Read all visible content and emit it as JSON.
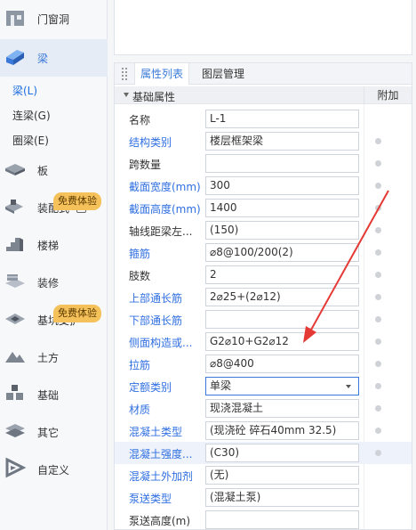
{
  "sidebar": {
    "items": [
      {
        "label": "门窗洞",
        "icon": "door-window-icon"
      },
      {
        "label": "梁",
        "icon": "beam-icon"
      },
      {
        "label": "板",
        "icon": "slab-icon"
      },
      {
        "label": "装配式",
        "icon": "prefab-icon"
      },
      {
        "label": "楼梯",
        "icon": "stairs-icon"
      },
      {
        "label": "装修",
        "icon": "decoration-icon"
      },
      {
        "label": "基坑支护",
        "icon": "foundation-pit-icon"
      },
      {
        "label": "土方",
        "icon": "earthwork-icon"
      },
      {
        "label": "基础",
        "icon": "foundation-icon"
      },
      {
        "label": "其它",
        "icon": "other-icon"
      },
      {
        "label": "自定义",
        "icon": "custom-icon"
      }
    ],
    "sub_items": [
      "梁(L)",
      "连梁(G)",
      "圈梁(E)"
    ],
    "badges": [
      "免费体验",
      "免费体验"
    ]
  },
  "panel": {
    "tabs": [
      "属性列表",
      "图层管理"
    ],
    "section_title": "基础属性",
    "extra_header": "附加",
    "rows": [
      {
        "name": "名称",
        "value": "L-1"
      },
      {
        "name": "结构类别",
        "value": "楼层框架梁"
      },
      {
        "name": "跨数量",
        "value": ""
      },
      {
        "name": "截面宽度(mm)",
        "value": "300"
      },
      {
        "name": "截面高度(mm)",
        "value": "1400"
      },
      {
        "name": "轴线距梁左...",
        "value": "(150)"
      },
      {
        "name": "箍筋",
        "value": "⌀8@100/200(2)"
      },
      {
        "name": "肢数",
        "value": "2"
      },
      {
        "name": "上部通长筋",
        "value": "2⌀25+(2⌀12)"
      },
      {
        "name": "下部通长筋",
        "value": ""
      },
      {
        "name": "侧面构造或...",
        "value": "G2⌀10+G2⌀12"
      },
      {
        "name": "拉筋",
        "value": "⌀8@400"
      },
      {
        "name": "定额类别",
        "value": "单梁"
      },
      {
        "name": "材质",
        "value": "现浇混凝土"
      },
      {
        "name": "混凝土类型",
        "value": "(现浇砼 碎石40mm 32.5)"
      },
      {
        "name": "混凝土强度...",
        "value": "(C30)"
      },
      {
        "name": "混凝土外加剂",
        "value": "(无)"
      },
      {
        "name": "泵送类型",
        "value": "(混凝土泵)"
      },
      {
        "name": "泵送高度(m)",
        "value": ""
      }
    ]
  },
  "colors": {
    "accent": "#3a79d9",
    "link": "#2f6fe0",
    "annotation_arrow": "#e53935",
    "badge": "#f5c15a"
  }
}
